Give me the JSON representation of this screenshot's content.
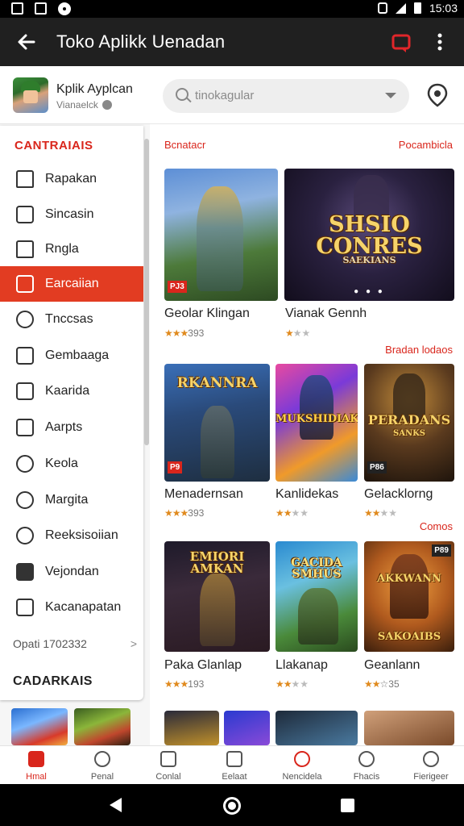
{
  "status_bar": {
    "time": "15:03"
  },
  "app_bar": {
    "title": "Toko Aplikk Uenadan"
  },
  "profile": {
    "name": "Kplik Ayplcan",
    "subtitle": "Vianaelck"
  },
  "search": {
    "placeholder": "tinokagular"
  },
  "drawer": {
    "section_title": "CANTRAIAIS",
    "items": [
      {
        "label": "Rapakan",
        "icon": "house-icon"
      },
      {
        "label": "Sincasin",
        "icon": "bag-icon"
      },
      {
        "label": "Rngla",
        "icon": "home-icon"
      },
      {
        "label": "Earcaiian",
        "icon": "square-icon",
        "active": true
      },
      {
        "label": "Tnccsas",
        "icon": "clock-icon"
      },
      {
        "label": "Gembaaga",
        "icon": "edit-icon"
      },
      {
        "label": "Kaarida",
        "icon": "k-icon"
      },
      {
        "label": "Aarpts",
        "icon": "pen-icon"
      },
      {
        "label": "Keola",
        "icon": "search-icon"
      },
      {
        "label": "Margita",
        "icon": "tag-icon"
      },
      {
        "label": "Reeksisoiian",
        "icon": "circle-icon"
      },
      {
        "label": "Vejondan",
        "icon": "folder-icon"
      },
      {
        "label": "Kacanapatan",
        "icon": "music-icon"
      }
    ],
    "footer_row": "Opati 1702332",
    "category_title": "CADARKAIS"
  },
  "main": {
    "section1": {
      "left": "Bcnatacr",
      "right": "Pocambicla"
    },
    "section2": {
      "right": "Bradan lodaos"
    },
    "section3": {
      "right": "Comos"
    },
    "row1": [
      {
        "title": "Geolar Klingan",
        "stars": "★★★",
        "rating": "393",
        "badge": "PJ3"
      },
      {
        "title": "Vianak Gennh",
        "stars": "★",
        "rating": "★★",
        "art": "SHSIO CONRES",
        "art_sub": "SAEKIANS"
      }
    ],
    "row2": [
      {
        "title": "Menadernsan",
        "stars": "★★★",
        "rating": "393",
        "badge": "P9",
        "art": "RKANNRA"
      },
      {
        "title": "Kanlidekas",
        "stars": "★★",
        "rating": "★★",
        "art": "MUKSHIDIAK"
      },
      {
        "title": "Gelacklorng",
        "stars": "★★",
        "rating": "★★",
        "art": "PERADANS",
        "art_sub": "SANKS",
        "badge": "P86"
      }
    ],
    "row3": [
      {
        "title": "Paka Glanlap",
        "stars": "★★★",
        "rating": "193",
        "art": "EMIORI AMKAN"
      },
      {
        "title": "Llakanap",
        "stars": "★★",
        "rating": "★★",
        "art": "GACIDA SMHUS"
      },
      {
        "title": "Geanlann",
        "stars": "★★",
        "rating": "☆35",
        "art": "AKKWANN",
        "art_sub": "SAKOAIBS",
        "badge": "P89"
      }
    ]
  },
  "bottom_nav": [
    {
      "label": "Hmal",
      "icon": "home-icon",
      "active": true
    },
    {
      "label": "Penal",
      "icon": "search-icon"
    },
    {
      "label": "Conlal",
      "icon": "list-icon"
    },
    {
      "label": "Eelaat",
      "icon": "box-icon"
    },
    {
      "label": "Nencidela",
      "icon": "alert-icon"
    },
    {
      "label": "Fhacis",
      "icon": "person-icon"
    },
    {
      "label": "Fierigeer",
      "icon": "clock-icon"
    }
  ]
}
